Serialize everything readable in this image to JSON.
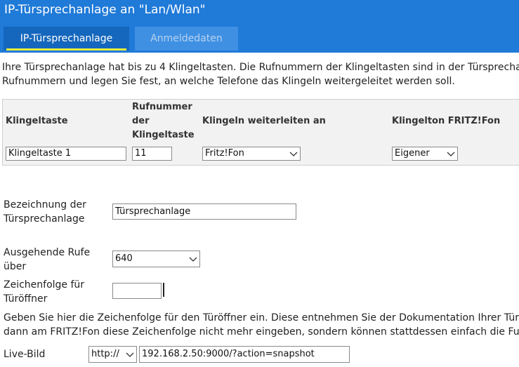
{
  "header": {
    "title": "IP-Türsprechanlage an \"Lan/Wlan\"",
    "tabs": [
      {
        "label": "IP-Türsprechanlage",
        "active": true
      },
      {
        "label": "Anmeldedaten",
        "active": false
      }
    ]
  },
  "intro": {
    "line1": "Ihre Türsprechanlage hat bis zu 4 Klingeltasten. Die Rufnummern der Klingeltasten sind in der Türsprechanlage",
    "line2": "Rufnummern und legen Sie fest, an welche Telefone das Klingeln weitergeleitet werden soll."
  },
  "bell_table": {
    "headers": {
      "button": "Klingeltaste",
      "number_line1": "Rufnummer",
      "number_line2": "der",
      "number_line3": "Klingeltaste",
      "forward": "Klingeln weiterleiten an",
      "ringtone": "Klingelton FRITZ!Fon"
    },
    "rows": [
      {
        "button_name": "Klingeltaste 1",
        "number": "11",
        "forward_to": "Fritz!Fon",
        "ringtone": "Eigener"
      }
    ]
  },
  "form": {
    "name_label_line1": "Bezeichnung der",
    "name_label_line2": "Türsprechanlage",
    "name_value": "Türsprechanlage",
    "outgoing_label_line1": "Ausgehende Rufe",
    "outgoing_label_line2": "über",
    "outgoing_value": "640",
    "opener_label_line1": "Zeichenfolge für",
    "opener_label_line2": "Türöffner",
    "opener_value": ""
  },
  "hint": {
    "line1": "Geben Sie hier die Zeichenfolge für den Türöffner ein. Diese entnehmen Sie der Dokumentation Ihrer Türsprech",
    "line2": "dann am FRITZ!Fon diese Zeichenfolge nicht mehr eingeben, sondern können stattdessen einfach die Funktion"
  },
  "live_image": {
    "label": "Live-Bild",
    "protocol": "http://",
    "url": "192.168.2.50:9000/?action=snapshot"
  },
  "colors": {
    "header_bg": "#1f7ad8",
    "tab_active_bg": "#1567bd",
    "tab_inactive_bg": "#3f90e3",
    "tab_underline": "#e8ec3c"
  },
  "icons": {
    "dropdown": "chevron-down-icon"
  }
}
